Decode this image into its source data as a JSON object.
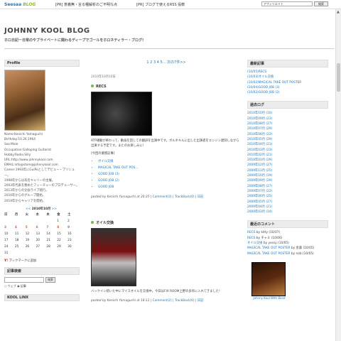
{
  "topbar": {
    "brand_main": "Seesaa",
    "brand_sub": "BLOG",
    "pr1": "[PR] 意義無・言る種解析のご不明な点",
    "pr2": "[PR] ブログで使えるRSS 役軟",
    "search_value": "アフィリエイト",
    "search_button": "検索"
  },
  "blog": {
    "title": "JOHNNY KOOL BLOG",
    "subtitle": "ホロ日記ー日常のやブライベートに関わるディープでゴールをホロネティラー・ブログ!"
  },
  "profile": {
    "heading": "Profile",
    "text": "Name:Kenichi Yamaguchi\nBirthday:10.26.1964\nSex:Male\nOccupation:Galloping Guitarist\nHobby:Rodio.Silly\nURL:http://www.johnnykool.com\nEMAIL:info@store@johnnykool.com\nCareer:1993年にGuiPoとしてデビュー・プリシュー。\n1998年からは有名キャリーの主催。\n2003年代表を務めたフィーチャーのプロデューサー。\n2013年からの企画ライブ続行。\n2016年からのグループ開始。\n2019年からキャリアを開始。"
  },
  "calendar": {
    "prev": "<<",
    "title": "2010年10月",
    "next": ">>",
    "dow": [
      "日",
      "月",
      "火",
      "水",
      "木",
      "金",
      "土"
    ],
    "cells": [
      "",
      "",
      "",
      "",
      "",
      "1",
      "2",
      "3",
      "4",
      "5",
      "6",
      "7",
      "8",
      "9",
      "10",
      "11",
      "12",
      "13",
      "14",
      "15",
      "16",
      "17",
      "18",
      "19",
      "20",
      "21",
      "22",
      "23",
      "24",
      "25",
      "26",
      "27",
      "28",
      "29",
      "30",
      "31",
      "",
      "",
      "",
      "",
      "",
      ""
    ],
    "linked": [
      "3",
      "4",
      "5",
      "6",
      "7",
      "8",
      "9"
    ]
  },
  "yahoo": {
    "brand": "Y!",
    "label": "ブックマークに追加"
  },
  "site_search": {
    "heading": "記事検索",
    "button": "検索",
    "radio1": "ウェブ",
    "radio2": "記事"
  },
  "kool_links": {
    "heading": "KOOL LINX"
  },
  "pager": {
    "label": "次の7件>>",
    "pages": "1 2 3 4 5..."
  },
  "posts": [
    {
      "date": "2010年10月10日",
      "title": "RECS",
      "body": "ATP運動が終わって、動画を回しての翻訳を出演中です。ボルネキルに出した出演者をエンジン遅刻しながら出演する予定です。またのお楽しみに！",
      "body2": "[今回の業務記事]",
      "list": [
        "ボイル交換",
        "MAGICAL TAKE OUT POS...",
        "GOOD JOB (3)",
        "GOOD JOB (2)",
        "GOOD JOB"
      ],
      "meta_prefix": "posted by Kenichi Yamaguchi at 20:35 | ",
      "comments": "Comment(3)",
      "trackback": "TrackBack(0)",
      "category": "日記"
    },
    {
      "title": "オイル交換",
      "body": "バックイン続いた中にマイスオイルを交換中。今日はFIX ROOM上野の多目に入れてきました!",
      "meta_prefix": "posted by Kenichi Yamaguchi at 18:13 | ",
      "comments": "Comment(2)",
      "trackback": "TrackBack(0)",
      "category": "日記"
    }
  ],
  "recent_posts": {
    "heading": "最新記事",
    "items": [
      "(10/05)RECS",
      "(10/03)オイル交換",
      "(10/02)MAGICAL TAKE OUT POSTER",
      "(10/04)GOOD JOB (3)",
      "(10/02)GOOD JOB (2)"
    ]
  },
  "archives": {
    "heading": "過去ログ",
    "items": [
      "2010年10月 (10)",
      "2010年09月 (23)",
      "2010年08月 (27)",
      "2010年07月 (29)",
      "2010年06月 (22)",
      "2010年05月 (29)",
      "2010年04月 (21)",
      "2010年03月 (23)",
      "2010年02月 (21)",
      "2010年01月 (29)",
      "2009年12月 (27)",
      "2009年11月 (25)",
      "2009年10月 (19)",
      "2009年09月 (29)",
      "2009年08月 (27)",
      "2009年07月 (22)",
      "2009年06月 (25)",
      "2009年05月 (27)",
      "2009年04月 (21)",
      "2009年03月 (14)"
    ]
  },
  "recent_comments": {
    "heading": "最近のコメント",
    "items": [
      {
        "title": "RECS",
        "by": " by kitty (10/07)"
      },
      {
        "title": "RECS",
        "by": " by チャミ (10/06)"
      },
      {
        "title": "オイル交換",
        "by": " by yossy (10/05)"
      },
      {
        "title": "MAGICAL TAKE OUT POSTER",
        "by": " by 金森 (10/05)"
      },
      {
        "title": "MAGICAL TAKE OUT POSTER",
        "by": " by nob (10/05)"
      }
    ]
  },
  "banner": {
    "caption": "Johnny Kool With Band"
  }
}
